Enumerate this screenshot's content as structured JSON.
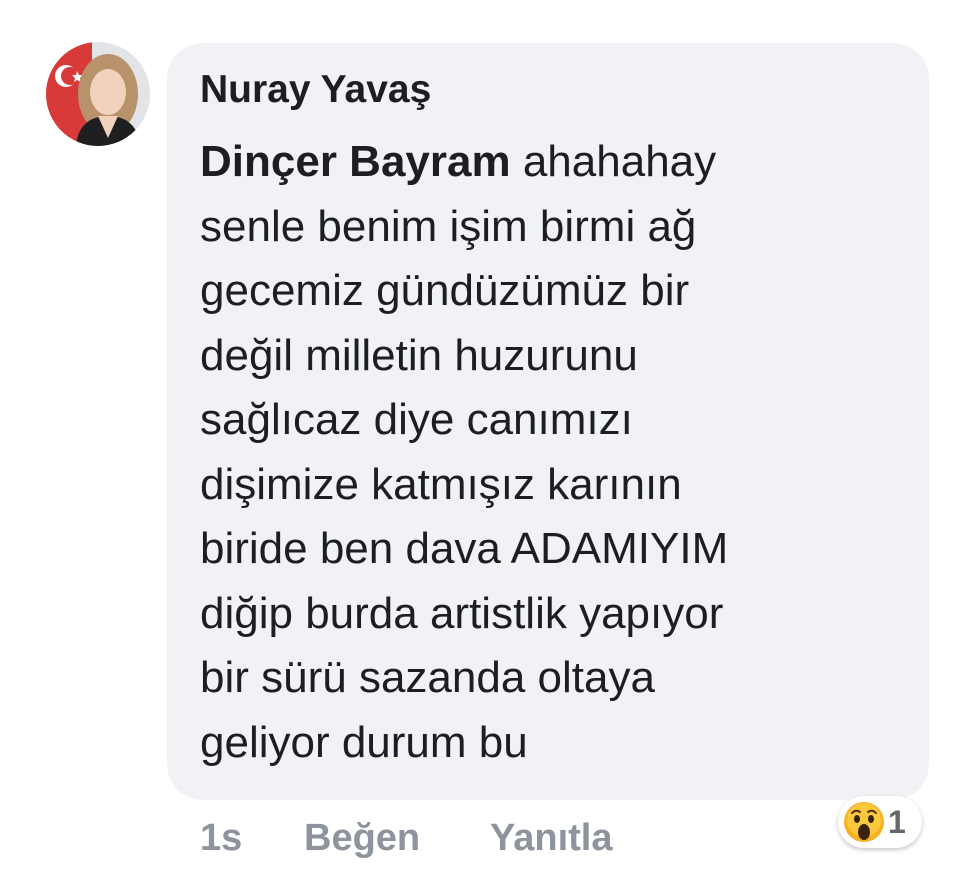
{
  "comment": {
    "author": "Nuray Yavaş",
    "mention": "Dinçer Bayram",
    "lines": [
      " ahahahay",
      "senle benim işim birmi ağ",
      "gecemiz gündüzümüz bir",
      "değil milletin huzurunu",
      "sağlıcaz diye canımızı",
      "dişimize katmışız karının",
      "biride ben dava ADAMIYIM",
      "diğip burda artistlik yapıyor",
      "bir sürü sazanda oltaya",
      "geliyor durum bu"
    ]
  },
  "actions": {
    "time": "1s",
    "like_label": "Beğen",
    "reply_label": "Yanıtla"
  },
  "reaction": {
    "icon": "wow-reaction-icon",
    "count": "1"
  },
  "colors": {
    "bubble": "#f0f2f5",
    "text": "#1c1e21",
    "action_text": "#8d949e",
    "wow_yellow": "#f7b125"
  }
}
